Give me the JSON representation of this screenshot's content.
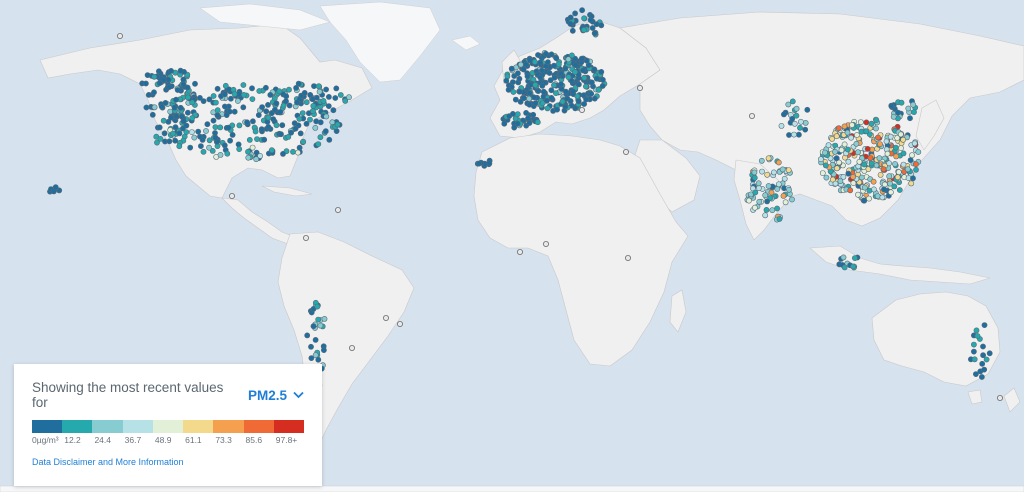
{
  "legend": {
    "showing_label": "Showing the most recent values for",
    "parameter": "PM2.5",
    "dropdown_icon": "chevron-down-icon",
    "scale_colors": [
      "#1f6e9e",
      "#26a9ad",
      "#86ccd0",
      "#b6e1e6",
      "#e1f0d6",
      "#f3d98c",
      "#f5a04f",
      "#ef6a35",
      "#d52d20"
    ],
    "scale_labels": [
      "0µg/m³",
      "12.2",
      "24.4",
      "36.7",
      "48.9",
      "61.1",
      "73.3",
      "85.6",
      "97.8+"
    ],
    "disclaimer_link": "Data Disclaimer and More Information"
  },
  "map": {
    "background_color": "#d6e2ee",
    "land_color": "#f0f0f0",
    "no_data_marker": "gray-outlined-marker"
  }
}
